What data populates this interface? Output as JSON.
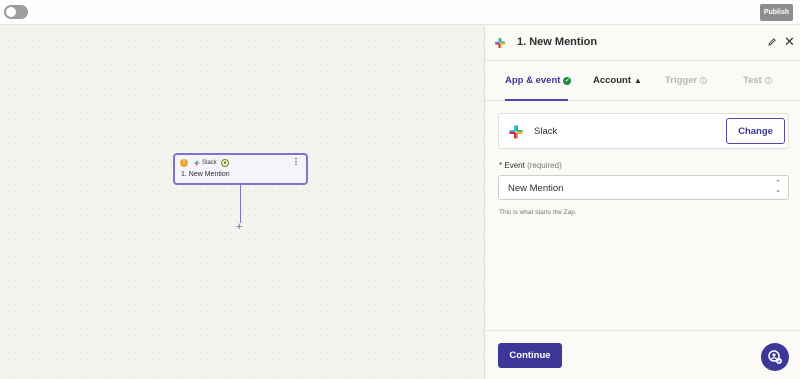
{
  "topbar": {
    "publish_label": "Publish"
  },
  "canvas": {
    "node": {
      "order_badge": "!",
      "app_label": "Slack",
      "title": "1. New Mention"
    },
    "add_step_symbol": "+"
  },
  "panel": {
    "title": "1. New Mention",
    "tabs": [
      {
        "label": "App & event",
        "state": "active"
      },
      {
        "label": "Account",
        "state": "warning"
      },
      {
        "label": "Trigger",
        "state": "disabled"
      },
      {
        "label": "Test",
        "state": "disabled"
      }
    ],
    "app": {
      "name": "Slack",
      "change_label": "Change"
    },
    "event_field": {
      "required_mark": "*",
      "label": "Event",
      "required_text": "(required)",
      "value": "New Mention",
      "help": "This is what starts the Zap."
    },
    "continue_label": "Continue"
  },
  "colors": {
    "accent": "#3d3799",
    "success": "#1c8a3e",
    "warning": "#f0a32b"
  },
  "icons": {
    "panel_app": "slack-icon",
    "edit": "pencil-icon",
    "close": "close-icon",
    "help": "help-chat-icon"
  }
}
